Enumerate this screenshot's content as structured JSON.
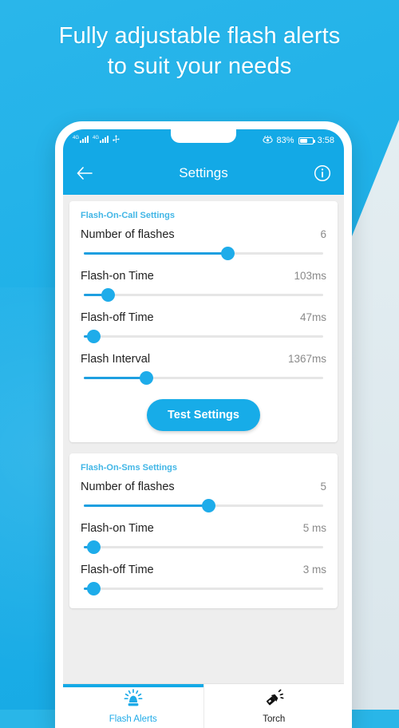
{
  "headline": {
    "line1": "Fully adjustable flash alerts",
    "line2": "to suit your needs"
  },
  "theme": {
    "primary": "#13a9e6",
    "accent": "#1eacea",
    "background": "#29b6e8",
    "card": "#ffffff",
    "scroll_bg": "#eeeeee"
  },
  "statusbar": {
    "signal_sup": "4G",
    "usb_icon": "usb-icon",
    "eye_icon": "eye-comfort-icon",
    "battery_percent": "83%",
    "time": "3:58"
  },
  "appbar": {
    "back_icon": "back-arrow-icon",
    "title": "Settings",
    "info_icon": "info-icon"
  },
  "cards": [
    {
      "title": "Flash-On-Call Settings",
      "rows": [
        {
          "label": "Number of flashes",
          "value": "6",
          "slider_percent": 60
        },
        {
          "label": "Flash-on Time",
          "value": "103ms",
          "slider_percent": 10
        },
        {
          "label": "Flash-off Time",
          "value": "47ms",
          "slider_percent": 4
        },
        {
          "label": "Flash Interval",
          "value": "1367ms",
          "slider_percent": 26
        }
      ],
      "button": "Test Settings"
    },
    {
      "title": "Flash-On-Sms Settings",
      "rows": [
        {
          "label": "Number of flashes",
          "value": "5",
          "slider_percent": 52
        },
        {
          "label": "Flash-on Time",
          "value": "5 ms",
          "slider_percent": 4
        },
        {
          "label": "Flash-off Time",
          "value": "3 ms",
          "slider_percent": 4
        }
      ]
    }
  ],
  "bottomnav": [
    {
      "label": "Flash Alerts",
      "icon": "siren-beacon-icon",
      "active": true
    },
    {
      "label": "Torch",
      "icon": "flashlight-icon",
      "active": false
    }
  ]
}
